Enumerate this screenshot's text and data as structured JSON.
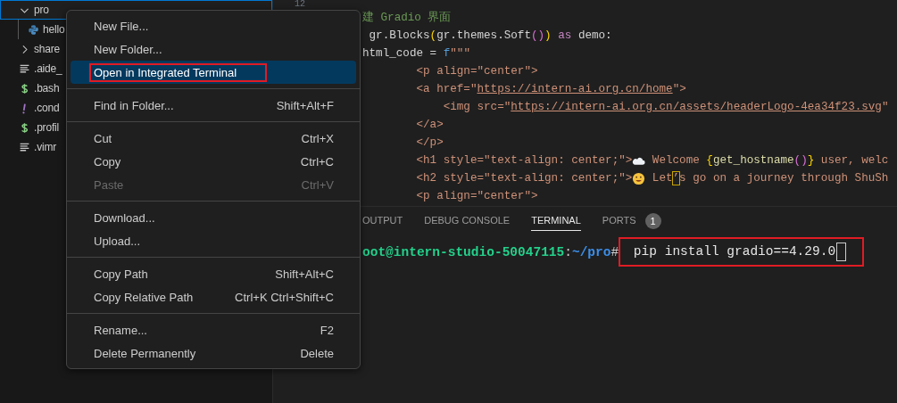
{
  "explorer": {
    "items": [
      {
        "name": "pro",
        "kind": "folder",
        "expanded": true,
        "selected": true,
        "children": [
          {
            "name": "hello",
            "kind": "python",
            "selected": false
          }
        ]
      },
      {
        "name": "share",
        "kind": "folder",
        "expanded": false,
        "selected": false
      },
      {
        "name": ".aide_",
        "kind": "lines",
        "selected": false
      },
      {
        "name": ".bash",
        "kind": "shell",
        "selected": false
      },
      {
        "name": ".cond",
        "kind": "warning",
        "selected": false
      },
      {
        "name": ".profil",
        "kind": "shell",
        "selected": false
      },
      {
        "name": ".vimr",
        "kind": "lines",
        "selected": false
      }
    ]
  },
  "editor": {
    "line_number": "12",
    "lines": [
      {
        "segs": [
          {
            "text": "建 Gradio 界面",
            "kind": "comment"
          }
        ]
      },
      {
        "segs": [
          {
            "text": " gr.Blocks",
            "kind": "plain"
          },
          {
            "text": "(",
            "kind": "brace"
          },
          {
            "text": "gr.themes.Soft",
            "kind": "plain"
          },
          {
            "text": "()",
            "kind": "paren"
          },
          {
            "text": ")",
            "kind": "brace"
          },
          {
            "text": " as",
            "kind": "keyword"
          },
          {
            "text": " demo:",
            "kind": "plain"
          }
        ]
      },
      {
        "segs": [
          {
            "text": "html_code",
            "kind": "plain"
          },
          {
            "text": " = ",
            "kind": "plain"
          },
          {
            "text": "f",
            "kind": "storage"
          },
          {
            "text": "\"\"\"",
            "kind": "string"
          }
        ]
      },
      {
        "segs": [
          {
            "text": "        <p align=\"center\">",
            "kind": "string"
          }
        ]
      },
      {
        "segs": [
          {
            "text": "        <a href=\"",
            "kind": "string"
          },
          {
            "text": "https://intern-ai.org.cn/home",
            "kind": "link"
          },
          {
            "text": "\">",
            "kind": "string"
          }
        ]
      },
      {
        "segs": [
          {
            "text": "            <img src=\"",
            "kind": "string"
          },
          {
            "text": "https://intern-ai.org.cn/assets/headerLogo-4ea34f23.svg",
            "kind": "link"
          },
          {
            "text": "\"",
            "kind": "string"
          }
        ]
      },
      {
        "segs": [
          {
            "text": "        </a>",
            "kind": "string"
          }
        ]
      },
      {
        "segs": [
          {
            "text": "        </p>",
            "kind": "string"
          }
        ]
      },
      {
        "segs": [
          {
            "text": "        <h1 style=\"text-align: center;\">",
            "kind": "string"
          }
        ],
        "kind": "cloud",
        "rest": [
          {
            "text": " Welcome ",
            "kind": "string"
          },
          {
            "text": "{",
            "kind": "brace"
          },
          {
            "text": "get_hostname",
            "kind": "func"
          },
          {
            "text": "()",
            "kind": "paren"
          },
          {
            "text": "}",
            "kind": "brace"
          },
          {
            "text": " user, welc",
            "kind": "string"
          }
        ]
      },
      {
        "segs": [
          {
            "text": "        <h2 style=\"text-align: center;\">",
            "kind": "string"
          }
        ],
        "kind": "face",
        "rest": [
          {
            "text": " Let",
            "kind": "string"
          },
          {
            "text": "’",
            "kind": "boxed"
          },
          {
            "text": "s go on a journey through ShuSh",
            "kind": "string"
          }
        ]
      },
      {
        "segs": [
          {
            "text": "        <p align=\"center\">",
            "kind": "string"
          }
        ]
      }
    ]
  },
  "panel": {
    "tabs": [
      {
        "label": "OUTPUT",
        "selected": false
      },
      {
        "label": "DEBUG CONSOLE",
        "selected": false
      },
      {
        "label": "TERMINAL",
        "selected": true
      },
      {
        "label": "PORTS",
        "selected": false,
        "badge": "1"
      }
    ],
    "terminal": {
      "user": "oot@intern-studio-50047115",
      "sep": ":",
      "path": "~/pro",
      "prompt": "#",
      "command": " pip install gradio==4.29.0",
      "highlighted": true
    }
  },
  "context_menu": {
    "groups": [
      [
        {
          "label": "New File...",
          "disabled": false,
          "selected": false,
          "highlighted": false
        },
        {
          "label": "New Folder...",
          "disabled": false,
          "selected": false,
          "highlighted": false
        },
        {
          "label": "Open in Integrated Terminal",
          "disabled": false,
          "selected": true,
          "highlighted": true
        }
      ],
      [
        {
          "label": "Find in Folder...",
          "shortcut": "Shift+Alt+F",
          "disabled": false,
          "selected": false,
          "highlighted": false
        }
      ],
      [
        {
          "label": "Cut",
          "shortcut": "Ctrl+X",
          "disabled": false,
          "selected": false,
          "highlighted": false
        },
        {
          "label": "Copy",
          "shortcut": "Ctrl+C",
          "disabled": false,
          "selected": false,
          "highlighted": false
        },
        {
          "label": "Paste",
          "shortcut": "Ctrl+V",
          "disabled": true,
          "selected": false,
          "highlighted": false
        }
      ],
      [
        {
          "label": "Download...",
          "disabled": false,
          "selected": false,
          "highlighted": false
        },
        {
          "label": "Upload...",
          "disabled": false,
          "selected": false,
          "highlighted": false
        }
      ],
      [
        {
          "label": "Copy Path",
          "shortcut": "Shift+Alt+C",
          "disabled": false,
          "selected": false,
          "highlighted": false
        },
        {
          "label": "Copy Relative Path",
          "shortcut": "Ctrl+K Ctrl+Shift+C",
          "disabled": false,
          "selected": false,
          "highlighted": false
        }
      ],
      [
        {
          "label": "Rename...",
          "shortcut": "F2",
          "disabled": false,
          "selected": false,
          "highlighted": false
        },
        {
          "label": "Delete Permanently",
          "shortcut": "Delete",
          "disabled": false,
          "selected": false,
          "highlighted": false
        }
      ]
    ]
  }
}
